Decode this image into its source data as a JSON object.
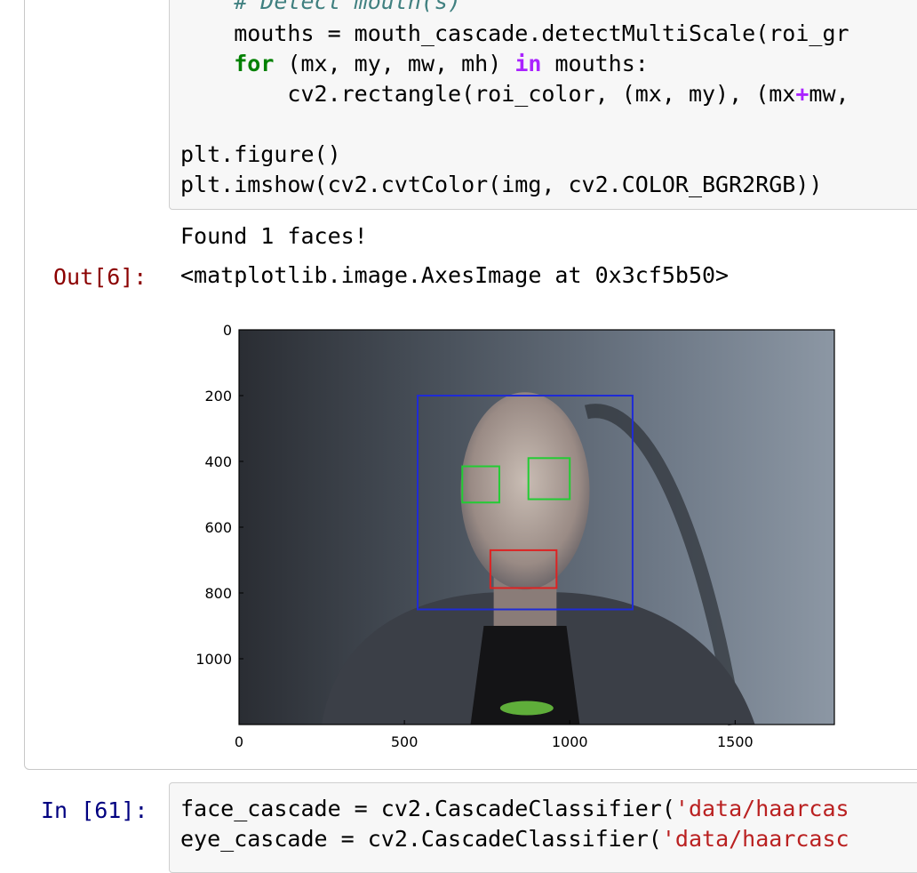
{
  "cell6": {
    "code_lines": [
      {
        "type": "comment",
        "text": "    # Detect mouth(s)"
      },
      {
        "type": "plain",
        "text": "    mouths = mouth_cascade.detectMultiScale(roi_gr"
      },
      {
        "type": "for",
        "indent": "    ",
        "kw_for": "for",
        "mid": " (mx, my, mw, mh) ",
        "kw_in": "in",
        "tail": " mouths:"
      },
      {
        "type": "rect",
        "head": "        cv2.rectangle(roi_color, (mx, my), (mx",
        "plus": "+",
        "tail": "mw,"
      },
      {
        "type": "plain",
        "text": ""
      },
      {
        "type": "plain",
        "text": "plt.figure()"
      },
      {
        "type": "plain",
        "text": "plt.imshow(cv2.cvtColor(img, cv2.COLOR_BGR2RGB))"
      }
    ],
    "stdout": "Found 1 faces!",
    "out_prompt": "Out[6]:",
    "out_text": "<matplotlib.image.AxesImage at 0x3cf5b50>"
  },
  "cell61": {
    "prompt": "In [61]:",
    "line1_head": "face_cascade = cv2.CascadeClassifier(",
    "line1_str": "'data/haarcas",
    "line2_head": "eye_cascade = cv2.CascadeClassifier(",
    "line2_str": "'data/haarcasc"
  },
  "chart_data": {
    "type": "image",
    "x_ticks": [
      "0",
      "500",
      "1000",
      "1500"
    ],
    "y_ticks": [
      "0",
      "200",
      "400",
      "600",
      "800",
      "1000"
    ],
    "xlim": [
      0,
      1800
    ],
    "ylim": [
      0,
      1200
    ],
    "detections": [
      {
        "label": "face",
        "color": "#1f2bd6",
        "x": 540,
        "y": 200,
        "w": 650,
        "h": 650
      },
      {
        "label": "eye",
        "color": "#22cc33",
        "x": 675,
        "y": 415,
        "w": 112,
        "h": 110
      },
      {
        "label": "eye",
        "color": "#22cc33",
        "x": 875,
        "y": 390,
        "w": 125,
        "h": 125
      },
      {
        "label": "mouth",
        "color": "#dd2222",
        "x": 760,
        "y": 670,
        "w": 200,
        "h": 115
      }
    ]
  }
}
